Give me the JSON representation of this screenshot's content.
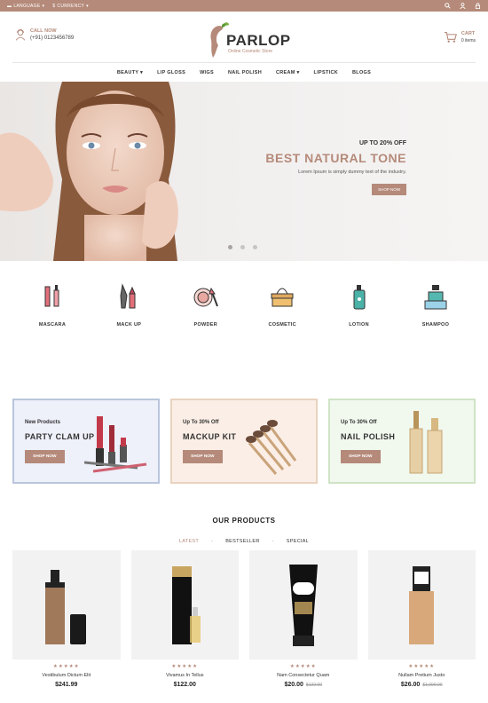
{
  "topbar": {
    "language": "LANGUAGE",
    "currency": "CURRENCY"
  },
  "header": {
    "call_label": "CALL NOW",
    "phone": "(+91) 0123456789",
    "logo_name": "PARLOP",
    "logo_tagline": "Online Cosmetic Store",
    "cart_label": "CART",
    "cart_items": "0 items"
  },
  "nav": [
    {
      "label": "BEAUTY",
      "dropdown": true
    },
    {
      "label": "LIP GLOSS",
      "dropdown": false
    },
    {
      "label": "WIGS",
      "dropdown": false
    },
    {
      "label": "NAIL POLISH",
      "dropdown": false
    },
    {
      "label": "CREAM",
      "dropdown": true
    },
    {
      "label": "LIPSTICK",
      "dropdown": false
    },
    {
      "label": "BLOGS",
      "dropdown": false
    }
  ],
  "hero": {
    "offer": "UP TO 20% OFF",
    "title": "BEST NATURAL TONE",
    "desc": "Lorem Ipsum is simply dummy text of the industry.",
    "button": "SHOP NOW"
  },
  "categories": [
    "MASCARA",
    "MACK UP",
    "POWDER",
    "COSMETIC",
    "LOTION",
    "SHAMPOO"
  ],
  "banners": [
    {
      "small": "New Products",
      "big": "PARTY CLAM UP",
      "button": "SHOP NOW",
      "bg": "#eef0fa",
      "border": "#b9c6dc"
    },
    {
      "small": "Up To 30% Off",
      "big": "MACKUP KIT",
      "button": "SHOP NOW",
      "bg": "#fbeee6",
      "border": "#e9d2bf"
    },
    {
      "small": "Up To 30% Off",
      "big": "NAIL POLISH",
      "button": "SHOP NOW",
      "bg": "#f1f8ee",
      "border": "#cfe3c5"
    }
  ],
  "products_section": {
    "heading": "OUR PRODUCTS",
    "tabs": [
      "LATEST",
      "BESTSELLER",
      "SPECIAL"
    ]
  },
  "products": [
    {
      "name": "Vestibulum Dictum Elit",
      "price": "$241.99",
      "old_price": ""
    },
    {
      "name": "Vivamus In Tellus",
      "price": "$122.00",
      "old_price": ""
    },
    {
      "name": "Nam Consectetur Quam",
      "price": "$20.00",
      "old_price": "$122.00"
    },
    {
      "name": "Nullam Pretium Justo",
      "price": "$26.00",
      "old_price": "$1,099.00"
    }
  ],
  "colors": {
    "accent": "#b58a7a"
  }
}
